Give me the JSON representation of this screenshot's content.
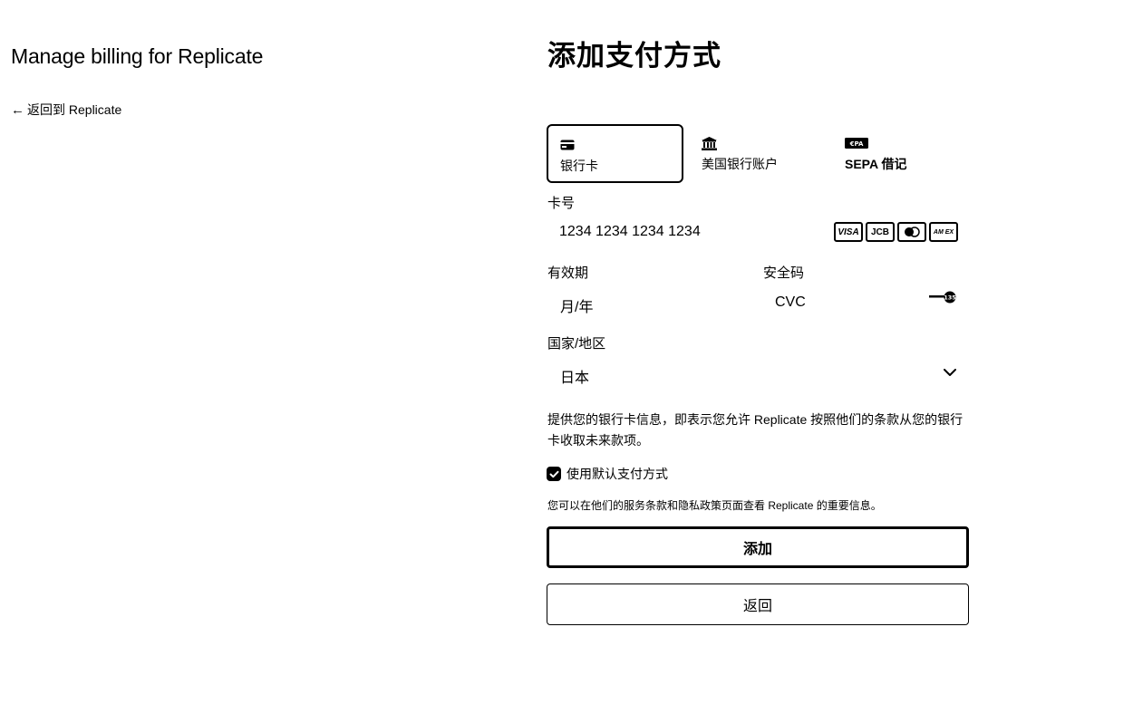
{
  "left": {
    "title": "Manage billing for Replicate",
    "back_arrow": "←",
    "back_label": "返回到 Replicate"
  },
  "main": {
    "title": "添加支付方式",
    "tabs": [
      {
        "label": "银行卡",
        "icon": "card-icon",
        "active": true
      },
      {
        "label": "美国银行账户",
        "icon": "bank-icon",
        "active": false
      },
      {
        "label": "SEPA 借记",
        "icon": "sepa-icon",
        "active": false
      }
    ],
    "card_number": {
      "label": "卡号",
      "placeholder": "1234 1234 1234 1234"
    },
    "card_brands": [
      "VISA",
      "JCB",
      "Mastercard",
      "AMEX"
    ],
    "card_brand_labels": {
      "visa": "VISA",
      "jcb": "JCB",
      "amex": "AM EX"
    },
    "expiry": {
      "label": "有效期",
      "placeholder": "月/年"
    },
    "cvc": {
      "label": "安全码",
      "placeholder": "CVC",
      "icon": "cvc-icon",
      "icon_text": "135"
    },
    "country": {
      "label": "国家/地区",
      "value": "日本"
    },
    "notice": "提供您的银行卡信息，即表示您允许 Replicate 按照他们的条款从您的银行卡收取未来款项。",
    "default_checkbox": {
      "label": "使用默认支付方式",
      "checked": true
    },
    "terms": "您可以在他们的服务条款和隐私政策页面查看 Replicate 的重要信息。",
    "add_button": "添加",
    "back_button": "返回"
  }
}
